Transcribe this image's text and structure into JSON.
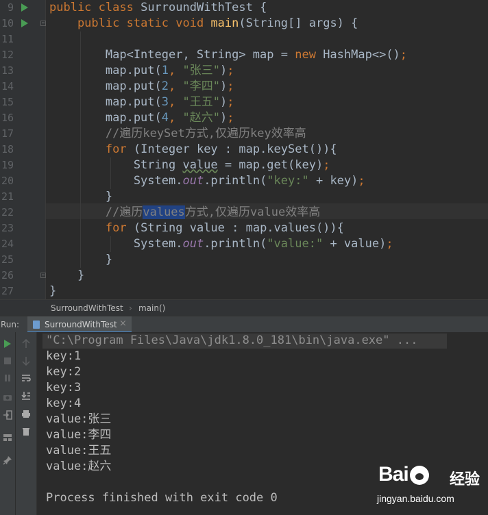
{
  "editor": {
    "line_numbers": [
      "9",
      "10",
      "11",
      "12",
      "13",
      "14",
      "15",
      "16",
      "17",
      "18",
      "19",
      "20",
      "21",
      "22",
      "23",
      "24",
      "25",
      "26",
      "27"
    ],
    "lines": [
      [
        {
          "t": "public ",
          "c": "kw"
        },
        {
          "t": "class ",
          "c": "kw"
        },
        {
          "t": "SurroundWithTest {",
          "c": ""
        }
      ],
      [
        {
          "t": "    public ",
          "c": "kw"
        },
        {
          "t": "static ",
          "c": "kw"
        },
        {
          "t": "void ",
          "c": "kw"
        },
        {
          "t": "main",
          "c": "fn"
        },
        {
          "t": "(String[] args) {",
          "c": ""
        }
      ],
      [],
      [
        {
          "t": "        Map<Integer, String> map = ",
          "c": ""
        },
        {
          "t": "new ",
          "c": "kw"
        },
        {
          "t": "HashMap<>()",
          "c": ""
        },
        {
          "t": ";",
          "c": "kw"
        }
      ],
      [
        {
          "t": "        map.put(",
          "c": ""
        },
        {
          "t": "1",
          "c": "num"
        },
        {
          "t": ", ",
          "c": "kw"
        },
        {
          "t": "\"张三\"",
          "c": "str"
        },
        {
          "t": ")",
          "c": ""
        },
        {
          "t": ";",
          "c": "kw"
        }
      ],
      [
        {
          "t": "        map.put(",
          "c": ""
        },
        {
          "t": "2",
          "c": "num"
        },
        {
          "t": ", ",
          "c": "kw"
        },
        {
          "t": "\"李四\"",
          "c": "str"
        },
        {
          "t": ")",
          "c": ""
        },
        {
          "t": ";",
          "c": "kw"
        }
      ],
      [
        {
          "t": "        map.put(",
          "c": ""
        },
        {
          "t": "3",
          "c": "num"
        },
        {
          "t": ", ",
          "c": "kw"
        },
        {
          "t": "\"王五\"",
          "c": "str"
        },
        {
          "t": ")",
          "c": ""
        },
        {
          "t": ";",
          "c": "kw"
        }
      ],
      [
        {
          "t": "        map.put(",
          "c": ""
        },
        {
          "t": "4",
          "c": "num"
        },
        {
          "t": ", ",
          "c": "kw"
        },
        {
          "t": "\"赵六\"",
          "c": "str"
        },
        {
          "t": ")",
          "c": ""
        },
        {
          "t": ";",
          "c": "kw"
        }
      ],
      [
        {
          "t": "        //遍历keySet方式,仅遍历key效率高",
          "c": "cmt"
        }
      ],
      [
        {
          "t": "        ",
          "c": ""
        },
        {
          "t": "for ",
          "c": "kw"
        },
        {
          "t": "(Integer key : map.keySet()){",
          "c": ""
        }
      ],
      [
        {
          "t": "            String ",
          "c": ""
        },
        {
          "t": "value",
          "c": "unused"
        },
        {
          "t": " = map.get(key)",
          "c": ""
        },
        {
          "t": ";",
          "c": "kw"
        }
      ],
      [
        {
          "t": "            System.",
          "c": ""
        },
        {
          "t": "out",
          "c": "stat"
        },
        {
          "t": ".println(",
          "c": ""
        },
        {
          "t": "\"key:\"",
          "c": "str"
        },
        {
          "t": " + key)",
          "c": ""
        },
        {
          "t": ";",
          "c": "kw"
        }
      ],
      [
        {
          "t": "        }",
          "c": ""
        }
      ],
      [
        {
          "t": "        //遍历",
          "c": "cmt"
        },
        {
          "t": "values",
          "c": "cmt hl"
        },
        {
          "t": "方式,仅遍历value效率高",
          "c": "cmt"
        }
      ],
      [
        {
          "t": "        ",
          "c": ""
        },
        {
          "t": "for ",
          "c": "kw"
        },
        {
          "t": "(String value : map.values()){",
          "c": ""
        }
      ],
      [
        {
          "t": "            System.",
          "c": ""
        },
        {
          "t": "out",
          "c": "stat"
        },
        {
          "t": ".println(",
          "c": ""
        },
        {
          "t": "\"value:\"",
          "c": "str"
        },
        {
          "t": " + value)",
          "c": ""
        },
        {
          "t": ";",
          "c": "kw"
        }
      ],
      [
        {
          "t": "        }",
          "c": ""
        }
      ],
      [
        {
          "t": "    }",
          "c": ""
        }
      ],
      [
        {
          "t": "}",
          "c": ""
        }
      ]
    ]
  },
  "breadcrumb": {
    "items": [
      "SurroundWithTest",
      "main()"
    ],
    "separator": "›"
  },
  "run_panel": {
    "label": "Run:",
    "tab_label": "SurroundWithTest",
    "tab_close": "×"
  },
  "console": {
    "lines": [
      "\"C:\\Program Files\\Java\\jdk1.8.0_181\\bin\\java.exe\" ...",
      "key:1",
      "key:2",
      "key:3",
      "key:4",
      "value:张三",
      "value:李四",
      "value:王五",
      "value:赵六",
      "",
      "Process finished with exit code 0"
    ]
  },
  "watermark": {
    "word_left": "Bai",
    "word_right": "经验",
    "url": "jingyan.baidu.com"
  },
  "colors": {
    "keyword": "#cc7832",
    "string": "#6a8759",
    "number": "#6897bb",
    "method": "#ffc66d",
    "static_field": "#9876aa",
    "comment": "#808080",
    "run_icon": "#499c54"
  }
}
